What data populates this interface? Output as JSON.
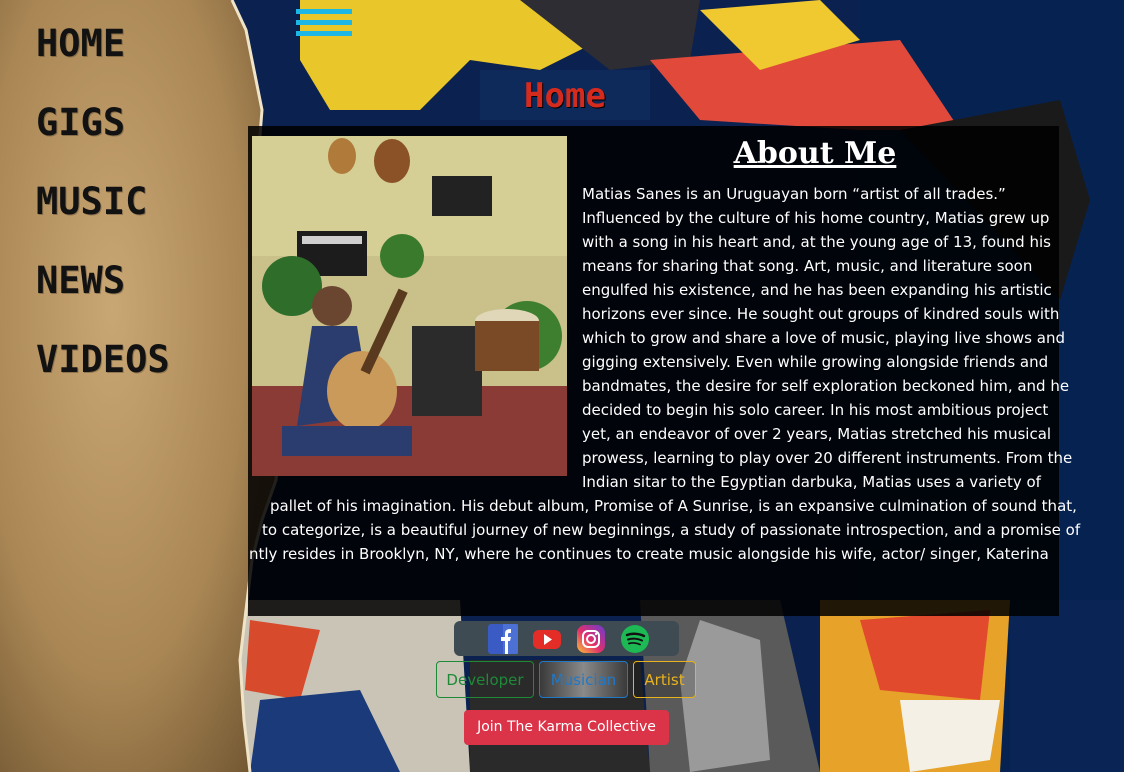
{
  "nav": {
    "items": [
      "HOME",
      "GIGS",
      "MUSIC",
      "NEWS",
      "VIDEOS"
    ]
  },
  "header": {
    "page_title": "Home"
  },
  "about": {
    "heading": "About Me",
    "lines": [
      "Matias Sanes is an Uruguayan born “artist of all trades.”",
      "Influenced by the culture of his home country, Matias grew up",
      "with a song in his heart and, at the young age of 13, found his",
      "means for sharing that song. Art, music, and literature soon",
      "engulfed his existence, and he has been expanding his artistic",
      "horizons ever since. He sought out groups of kindred souls with",
      "which to grow and share a love of music, playing live shows and",
      "gigging extensively. Even while growing alongside friends and",
      "bandmates, the desire for self exploration beckoned him, and he",
      "decided to begin his solo career. In his most ambitious project",
      "yet, an endeavor of over 2 years, Matias stretched his musical",
      "prowess, learning to play over 20 different instruments. From the",
      "Indian sitar to the Egyptian darbuka, Matias uses a variety of"
    ],
    "overflow_lines": [
      "pallet of his imagination. His debut album, Promise of A Sunrise, is an expansive culmination of sound that,",
      "to categorize, is a beautiful journey of new beginnings, a study of passionate introspection, and a promise of",
      "ntly resides in Brooklyn, NY, where he continues to create music alongside his wife, actor/ singer, Katerina"
    ]
  },
  "social": {
    "icons": [
      "facebook-icon",
      "youtube-icon",
      "instagram-icon",
      "spotify-icon"
    ]
  },
  "roles": {
    "developer": "Developer",
    "musician": "Musician",
    "artist": "Artist"
  },
  "cta": {
    "join_label": "Join The Karma Collective"
  },
  "colors": {
    "accent_blue": "#1cb7e6",
    "title_red": "#d52a1e",
    "join_red": "#db3348",
    "developer_green": "#1e8a38",
    "musician_blue": "#1f78c8",
    "artist_gold": "#e8b21f"
  }
}
